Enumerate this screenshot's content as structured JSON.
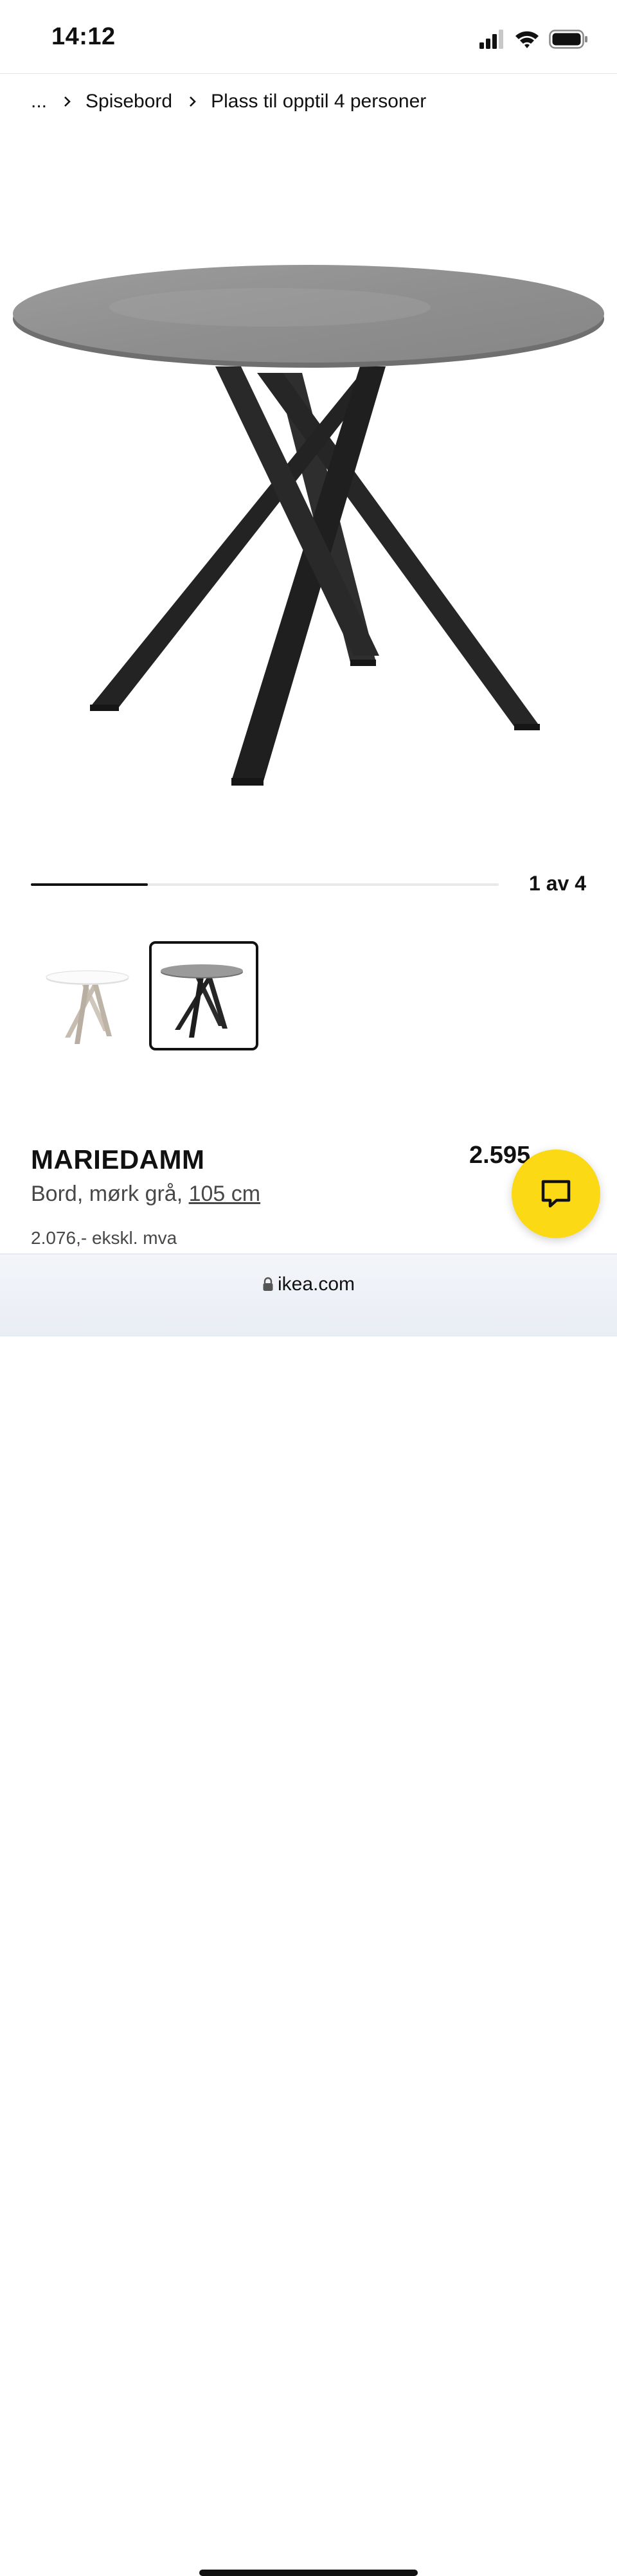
{
  "status_bar": {
    "time": "14:12"
  },
  "breadcrumb": {
    "ellipsis": "...",
    "items": [
      "Spisebord",
      "Plass til opptil 4 personer"
    ]
  },
  "gallery": {
    "counter": "1 av 4",
    "progress": 0.25,
    "thumbnails": [
      {
        "variant": "white table, beige legs",
        "selected": false
      },
      {
        "variant": "dark grey table, black legs",
        "selected": true
      }
    ]
  },
  "product": {
    "name": "MARIEDAMM",
    "desc_prefix": "Bord, mørk grå, ",
    "size": "105 cm",
    "price": "2.595",
    "price_ex_vat": "2.076,- ekskl. mva"
  },
  "browser": {
    "domain": "ikea.com"
  },
  "colors": {
    "accent_yellow": "#FBD914",
    "text": "#111111",
    "muted": "#484848"
  },
  "icons": [
    "signal-icon",
    "wifi-icon",
    "battery-icon",
    "chevron-right-icon",
    "chat-icon",
    "lock-icon"
  ]
}
